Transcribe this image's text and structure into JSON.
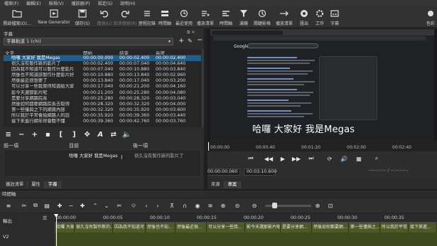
{
  "menubar": [
    "檔案(F)",
    "編輯(E)",
    "檢視(V)",
    "播放器(P)",
    "設定(S)",
    "說明(H)"
  ],
  "toolbar": [
    {
      "label": "開啟檔案(O)...",
      "icon": "folder-open-icon",
      "enabled": true
    },
    {
      "label": "New Generator",
      "icon": "new-generator-icon",
      "enabled": true
    },
    {
      "label": "儲存(S)",
      "icon": "save-icon",
      "enabled": true
    },
    {
      "label": "復原(U)",
      "icon": "undo-icon",
      "enabled": false
    },
    {
      "label": "取消復原(R)",
      "icon": "redo-icon",
      "enabled": false
    },
    {
      "label": "歷程記錄",
      "icon": "history-icon",
      "enabled": true
    },
    {
      "label": "時間軸",
      "icon": "timeline-icon",
      "enabled": true
    },
    {
      "label": "濾鏡",
      "icon": "filter-icon",
      "enabled": true
    },
    {
      "label": "關鍵影格",
      "icon": "keyframes-icon",
      "enabled": true
    },
    {
      "label": "匯出",
      "icon": "export-icon",
      "enabled": true
    },
    {
      "label": "屬性",
      "icon": "properties-icon",
      "enabled": true
    },
    {
      "label": "最近使用",
      "icon": "recent-icon",
      "enabled": true
    },
    {
      "label": "播放清單",
      "icon": "playlist-icon",
      "enabled": true
    },
    {
      "label": "工作",
      "icon": "jobs-icon",
      "enabled": true
    },
    {
      "label": "字幕",
      "icon": "subtitles-icon",
      "enabled": true
    },
    {
      "label": "色彩",
      "icon": "color-icon",
      "enabled": true
    }
  ],
  "subtitles_panel": {
    "title": "字幕",
    "track": "字幕軌道 1 (chi)",
    "columns": [
      "文字",
      "開始",
      "結束",
      "長度"
    ],
    "rows": [
      [
        "哈囉 大家好 我是Megas",
        "00:00:00.000",
        "00:00:02.400",
        "00:00:02.400"
      ],
      [
        "很久沒有製作新的影片了",
        "00:00:02.400",
        "00:00:07.040",
        "00:00:04.640"
      ],
      [
        "因為我不知道可以製作什麼影片",
        "00:00:07.040",
        "00:00:10.880",
        "00:00:03.840"
      ],
      [
        "然後也不知道該製作什麼影片好",
        "00:00:10.880",
        "00:00:13.840",
        "00:00:02.960"
      ],
      [
        "然後最近很想要了",
        "00:00:13.840",
        "00:00:17.040",
        "00:00:03.200"
      ],
      [
        "可以分享一些我覺得知道給大家",
        "00:00:17.040",
        "00:00:21.200",
        "00:00:04.160"
      ],
      [
        "影今天選那影片呢",
        "00:00:21.200",
        "00:00:25.280",
        "00:00:04.080"
      ],
      [
        "是要分享網路院長",
        "00:00:25.280",
        "00:00:28.320",
        "00:00:03.040"
      ],
      [
        "然後如何都要網路院長去取得",
        "00:00:28.320",
        "00:00:32.320",
        "00:00:04.000"
      ],
      [
        "第一些僅與之下的網頁內容",
        "00:00:32.320",
        "00:00:35.920",
        "00:00:03.600"
      ],
      [
        "所以我於平常會給網路人的話",
        "00:00:35.920",
        "00:00:39.360",
        "00:00:03.440"
      ],
      [
        "接下來進行網年得會聽不懂",
        "00:00:39.360",
        "00:00:42.760",
        "00:00:03.760"
      ]
    ],
    "selected_row": 0,
    "prev_label": "前一項",
    "current_label": "目前",
    "next_label": "後一項",
    "prev_text": "",
    "current_text": "哈囉 大家好 我是Megas",
    "next_text": "很久沒有製作新的影片了",
    "tabs": [
      "播放清單",
      "屬性",
      "字幕"
    ],
    "active_tab": 2
  },
  "player": {
    "overlay_subtitle": "哈囉 大家好 我是Megas",
    "browser_logo": "Google",
    "ruler_ticks": [
      "00:00:00",
      "00:00:40",
      "00:01:20",
      "00:02:00",
      "00:02:40"
    ],
    "current_time": "00:00:00.060",
    "total_time": "00:03:10.600",
    "in_out": "--:--:--:-- / --:--:--:--",
    "tabs": [
      "來源",
      "專案"
    ],
    "active_tab": 1
  },
  "timeline": {
    "title": "時間軸",
    "tracks": [
      "輸出",
      "",
      "V2"
    ],
    "ruler_ticks": [
      "00:00:00",
      "00:00:05",
      "00:00:10",
      "00:00:15",
      "00:00:20",
      "00:00:25",
      "00:00:30",
      "00:00:35"
    ],
    "clips": [
      "哈囉 大家...",
      "很久沒有製作新的...",
      "因為我不知道可...",
      "然後也不知...",
      "然後最近很...",
      "可以分享一些我...",
      "影今天選那影片呢",
      "是要分享網...",
      "然後如何都要網...",
      "第一些僅與之...",
      "所以我於平常...",
      "接下來進..."
    ]
  },
  "colors": {
    "selection": "#1c5e8e",
    "clip_track": "#4c5a24",
    "background": "#2b2b2b"
  }
}
